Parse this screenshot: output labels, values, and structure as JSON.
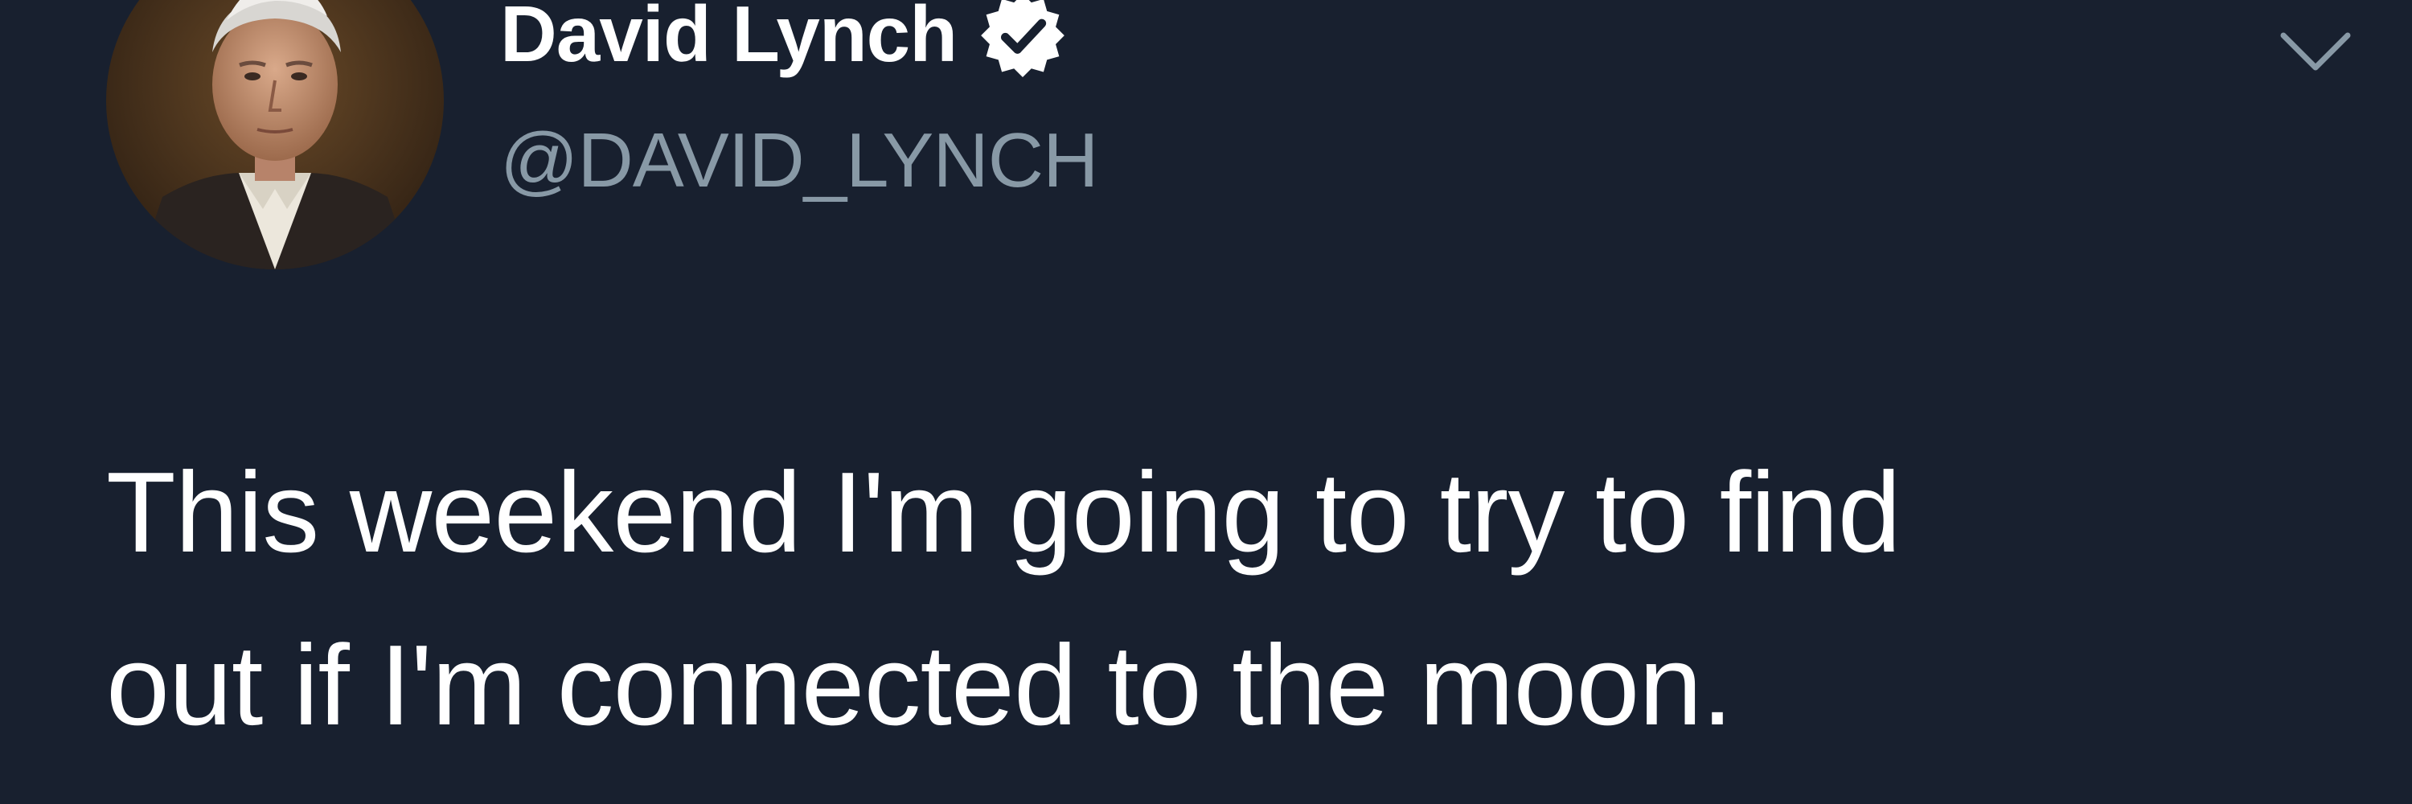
{
  "author": {
    "display_name": "David Lynch",
    "handle": "@DAVID_LYNCH",
    "verified": true,
    "avatar_icon": "user-portrait-avatar"
  },
  "tweet": {
    "text_lines": [
      "This weekend I'm going to try to find",
      "out if I'm connected to the moon."
    ]
  },
  "icons": {
    "verified": "verified-badge-icon",
    "menu": "chevron-down-icon"
  },
  "colors": {
    "background": "#18202f",
    "text_primary": "#ffffff",
    "text_secondary": "#8899a6"
  }
}
